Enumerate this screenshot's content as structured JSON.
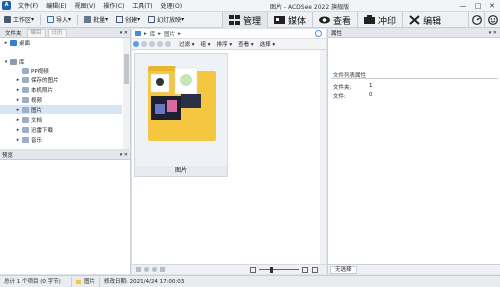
{
  "titlebar": {
    "menu": [
      "文件(F)",
      "编辑(E)",
      "视图(V)",
      "操作(C)",
      "工具(T)",
      "处理(O)"
    ],
    "title": "图片 - ACDSee 2022 旗舰版",
    "controls": [
      "—",
      "□",
      "✕"
    ]
  },
  "toolbar": {
    "items": [
      "工作区",
      "导入",
      "批量",
      "创建",
      "幻灯放映"
    ],
    "modes": [
      "管理",
      "媒体",
      "查看",
      "冲印",
      "编辑"
    ]
  },
  "folders_panel": {
    "tabs": [
      "文件夹",
      "编目",
      "日历"
    ],
    "tree": [
      {
        "label": "桌面",
        "icon_color": "#2f7fd8",
        "expand": "▸"
      },
      {
        "label": "库",
        "icon_color": "#8a9bb0",
        "expand": "▾"
      },
      {
        "label": "PP视频",
        "icon_color": "#9bb0c8",
        "expand": ""
      },
      {
        "label": "保存的图片",
        "icon_color": "#9bb0c8",
        "expand": "▸"
      },
      {
        "label": "本机照片",
        "icon_color": "#9bb0c8",
        "expand": "▸"
      },
      {
        "label": "视频",
        "icon_color": "#9bb0c8",
        "expand": "▸"
      },
      {
        "label": "图片",
        "icon_color": "#9bb0c8",
        "expand": "▸"
      },
      {
        "label": "文档",
        "icon_color": "#9bb0c8",
        "expand": "▸"
      },
      {
        "label": "迅雷下载",
        "icon_color": "#9bb0c8",
        "expand": "▸"
      },
      {
        "label": "音乐",
        "icon_color": "#9bb0c8",
        "expand": "▸"
      }
    ],
    "selected_index": 6
  },
  "preview_panel": {
    "title": "预览"
  },
  "browser": {
    "breadcrumb": [
      "库",
      "图片"
    ],
    "toolbar": [
      "过滤",
      "组",
      "排序",
      "查看",
      "选择"
    ],
    "items": [
      {
        "label": "图片"
      }
    ]
  },
  "properties": {
    "title": "属性",
    "section": "文件列表属性",
    "rows": [
      {
        "label": "文件夹:",
        "value": "1"
      },
      {
        "label": "文件:",
        "value": "0"
      }
    ],
    "bottom_tab": "无选择"
  },
  "statusbar": {
    "total": "总计 1 个项目 (0 字节)",
    "item": "图片",
    "modified": "修改日期: 2021/4/24 17:00:03"
  },
  "colors": {
    "accent": "#1f5fa8",
    "folder": "#f5c63f",
    "selection": "#d7e4f4"
  }
}
